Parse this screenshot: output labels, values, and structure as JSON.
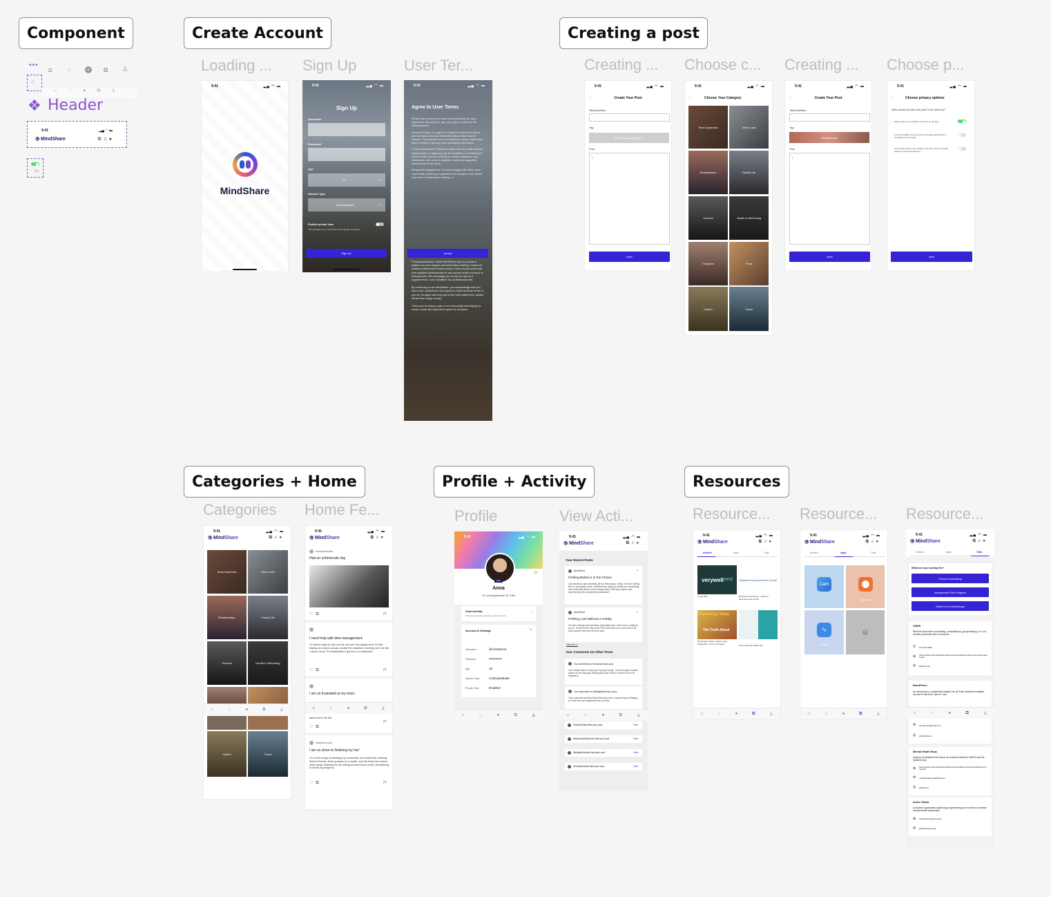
{
  "sections": {
    "component": "Component",
    "create_account": "Create Account",
    "creating_post": "Creating a post",
    "categories_home": "Categories + Home",
    "profile_activity": "Profile + Activity",
    "resources": "Resources"
  },
  "frames": {
    "loading": "Loading ...",
    "signup": "Sign Up",
    "terms": "User Ter...",
    "creating1": "Creating ...",
    "choose_cat": "Choose c...",
    "creating2": "Creating ...",
    "choose_priv": "Choose p...",
    "categories": "Categories",
    "home": "Home Fe...",
    "profile": "Profile",
    "activity": "View Acti...",
    "res1": "Resource...",
    "res2": "Resource...",
    "res3": "Resource..."
  },
  "component": {
    "header_label": "Header",
    "brand": "MindShare",
    "time": "9:41"
  },
  "common": {
    "time": "9:41",
    "brand_a": "Mind",
    "brand_b": "Share",
    "next": "Next"
  },
  "loading": {
    "brand": "MindShare"
  },
  "signup": {
    "title": "Sign Up",
    "username": "Username",
    "password": "Password",
    "age": "Age",
    "age_value": "19",
    "student_type": "Student Type",
    "student_value": "Undergraduate",
    "private_chat": "Enable private chat",
    "private_desc": "This will allow you to send and receive private messages",
    "button": "Sign Up"
  },
  "terms": {
    "title": "Agree to User Terms",
    "intro": "Please take a moment to read and understand our User Agreement. By using our app, you agree to abide by the following terms:",
    "privacy": "Respect Privacy: You agree to respect the privacy of others and not share personal information without their explicit consent. This includes but is not limited to names, addresses, phone numbers, and any other identifying information.",
    "moderation": "Content Moderation: Please be aware that any posts deemed inappropriate or triggering may be escalated to Counseling & Mental Health Service (CMHS) for further assistance and intervention. We strive to maintain a safe and supportive environment for all users.",
    "engagement": "Respectful Engagement: You must engage with other users respectfully, fostering a supportive and inclusive environment. Any form of harassment, bullying, or",
    "button": "Accept",
    "advice": "Professional Advice: While MindShare aims to provide a platform for peer support and information sharing, it does not replace professional medical advice. Users should seek help from qualified professionals for any mental health concerns or emergencies. We encourage you to use our app as a supplement to, not a substitute for, professional care.",
    "continue": "By continuing to use MindShare, you acknowledge that you have read, understood, and agreed to abide by these terms. If you do not agree with any part of this User Agreement, please refrain from using our app.",
    "thanks": "Thank you for being a part of our community and helping us create a safe and supportive space for everyone."
  },
  "post": {
    "title": "Create Your Post",
    "title_q": "Title/Question",
    "tag": "Tag",
    "tag_placeholder": "Choose your category >>",
    "tag_selected": "Relationships",
    "post": "Post"
  },
  "categories": {
    "title": "Choose Your Category",
    "items": [
      "Team Dynamics",
      "Work Load",
      "Relationships",
      "Family Life",
      "General",
      "Health & Well-being",
      "Finances",
      "Food",
      "Culture",
      "Travel"
    ]
  },
  "privacy": {
    "title": "Choose privacy options",
    "question": "Who would you like this post to be seen by?",
    "opt1": "Allows users to be visible to all users on the app.",
    "opt2": "Limit the visibility of your post to only approved friends or connections on the app.",
    "opt3": "Post content that is only visible to yourself. This is a private space for personal reflection."
  },
  "home": {
    "user1": "anonymousUser",
    "post1": "Had an unfortunate day.",
    "post2_title": "I need help with time management.",
    "post2_body": "I'm about ready to pull my hair out over this assignment. It's like staring at a blank canvas, except the deadline's looming over me like a storm cloud. Procrastination's got me in a chokehold.",
    "post3_title": "I am so frustrated at my mom.",
    "post3_body": "adds fuel to the fire.",
    "user4": "sleepless.count",
    "post4_title": "I am so close to finishing my hw!",
    "post4_body": "I'm on the verge of finishing my homework, but it feels like climbing Mount Everest. Each question is a hurdle, and the finish line seems miles away. Distractions are lurking around every corner, threatening to derail my progress."
  },
  "profile": {
    "name": "Anna",
    "sub": "19, Undergraduate @ Tufts",
    "badge": "Edit",
    "view_activity": "View Activity",
    "view_desc": "View all your posts, upvotes, and comments",
    "settings": "Account & Settings",
    "rows": [
      {
        "k": "Username",
        "v": "@Ana23nna"
      },
      {
        "k": "Password",
        "v": "••••••••••••"
      },
      {
        "k": "Age",
        "v": "19"
      },
      {
        "k": "Student Type",
        "v": "Undergraduate"
      },
      {
        "k": "Private Chat",
        "v": "Enabled"
      }
    ]
  },
  "activity": {
    "recent": "Your Recent Posts",
    "user": "Ana23nna",
    "p1_title": "Finding Balance in the Chaos",
    "p1_body": "Just needed to get something off my chest today. Lately, I've been feeling like I'm drowning in work. Deadlines are piling up, emails are overflowing, and it feels like there's never enough time in the day. Anyone else experiencing this overwhelming workload?",
    "p2_title": "Feeling Lost Without a Hobby",
    "p2_body": "I've been feeling a bit lost lately, especially since I don't have a hobby to turn to. It's like there's this void of free time that I'm not sure how to fill. Does anyone else ever feel this way?",
    "view_all": "View all >>",
    "comments": "Your Comments On Other Posts",
    "c1_head": "You commented on DreamweSouls post:",
    "c1_body": "I can totally relate to what you're going through. I went through a similar phase not too long ago, feeling stuck and unsure of where to turn for inspiration.",
    "c2_head": "You commented on MidnightDreamer's post:",
    "c2_body": "This is just the sweetest thing! Tells truly have a special way of bringing so much love and happiness into our lives.",
    "likes": [
      "SunshineDays liked your post.",
      "WandererlustExplorer liked your post.",
      "MidnightDreamer liked your post.",
      "SerenitySeekers liked your post."
    ],
    "view": "View"
  },
  "resources": {
    "tabs": [
      "Articles",
      "Apps",
      "Tufts"
    ],
    "art1_brand": "verywell",
    "art1_brand_b": "mind",
    "art2_brand": "National Empowerment Center",
    "art3_brand": "Psychology Today",
    "art3_headline": "The Truth About",
    "art1_caption": "Living Well",
    "art2_caption": "Research & Evidence - National Empowerment Center",
    "art3_caption": "Psychology Today: Health, Help, Happiness + Find a Therapist",
    "art4_caption": "New to Mental Health Test",
    "app1": "Calm",
    "app2": "Headspace",
    "app3": "Breathe",
    "tufts_q": "What are you looking for?",
    "tufts_btns": [
      "Formal Counseling",
      "Anonymous Peer Support",
      "Student-run Workshops"
    ],
    "cmhs": "CMHS",
    "cmhs_desc": "Receive short-term counseling, consultations, group therapy, or a 15-minute phonecall with a counselor",
    "cmhs_phone": "617-627-3360",
    "cmhs_url": "https://students.tufts.edu/health-wellness/mental-health/counseling-and-mental-health-service",
    "cmhs_ig": "@tuftscmhs",
    "e4p": "Ears4Peers",
    "e4p_desc": "An anonymous, confidential helpline for all Tufts students available via call or text from 7pm to 7am",
    "e4p_mail": "ears4peers@gmail.com",
    "e4p_ig": "@ears4peers",
    "mhr": "Mental Health Reps",
    "mhr_desc": "A group of students who serve as a liaison between CMHS and the student body",
    "mhr_url": "https://students.tufts.edu/health-wellness/mental-health/our-services/workshops-and-outreach",
    "mhr_mail": "mentalhealthreps@tufts.edu",
    "mhr_ig": "@tuftsmhr",
    "am": "Active Minds",
    "am_desc": "A student organization planning programming and events to increase mental health awareness",
    "am_url": "https://tufts.edu/activeminds",
    "am_ig": "@tuftsactiveminds"
  },
  "colors": {
    "primary": "#3523d6",
    "brand_purple": "#7b3fe0",
    "toggle_on": "#4cd964",
    "canvas": "#f5f5f5"
  }
}
